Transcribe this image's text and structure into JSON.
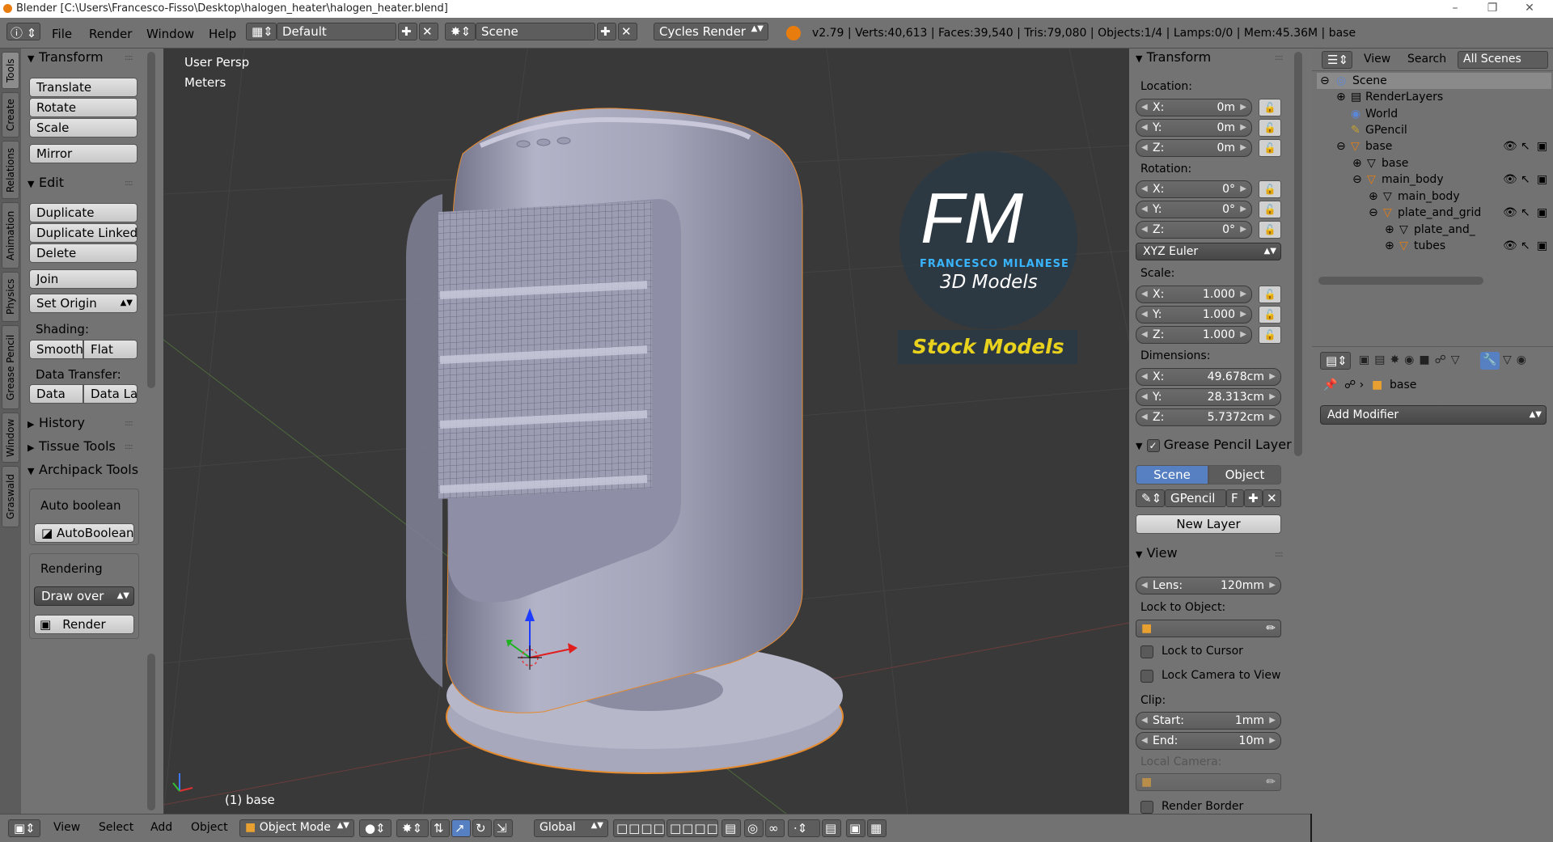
{
  "window": {
    "title": "Blender [C:\\Users\\Francesco-Fisso\\Desktop\\halogen_heater\\halogen_heater.blend]"
  },
  "info": {
    "menus": [
      "File",
      "Render",
      "Window",
      "Help"
    ],
    "layout": "Default",
    "scene": "Scene",
    "engine": "Cycles Render",
    "stats": "v2.79 | Verts:40,613 | Faces:39,540 | Tris:79,080 | Objects:1/4 | Lamps:0/0 | Mem:45.36M | base"
  },
  "tooltabs": [
    "Tools",
    "Create",
    "Relations",
    "Animation",
    "Physics",
    "Grease Pencil",
    "Window",
    "Graswald"
  ],
  "toolshelf": {
    "transform_title": "Transform",
    "translate": "Translate",
    "rotate": "Rotate",
    "scale": "Scale",
    "mirror": "Mirror",
    "edit_title": "Edit",
    "duplicate": "Duplicate",
    "duplicate_linked": "Duplicate Linked",
    "delete": "Delete",
    "join": "Join",
    "set_origin": "Set Origin",
    "shading_label": "Shading:",
    "smooth": "Smooth",
    "flat": "Flat",
    "data_transfer_label": "Data Transfer:",
    "data": "Data",
    "data_la": "Data La",
    "history": "History",
    "tissue": "Tissue Tools",
    "archipack": "Archipack Tools",
    "auto_boolean_label": "Auto boolean",
    "autoboolean": "AutoBoolean",
    "rendering_label": "Rendering",
    "draw_over": "Draw over",
    "render": "Render"
  },
  "viewport": {
    "view_name": "User Persp",
    "units": "Meters",
    "object_label": "(1) base",
    "logo_letters": "FM",
    "logo_name": "FRANCESCO MILANESE",
    "logo_sub": "3D Models",
    "logo_stock": "Stock Models"
  },
  "npanel": {
    "transform_title": "Transform",
    "location_label": "Location:",
    "loc": [
      {
        "axis": "X:",
        "value": "0m"
      },
      {
        "axis": "Y:",
        "value": "0m"
      },
      {
        "axis": "Z:",
        "value": "0m"
      }
    ],
    "rotation_label": "Rotation:",
    "rot": [
      {
        "axis": "X:",
        "value": "0°"
      },
      {
        "axis": "Y:",
        "value": "0°"
      },
      {
        "axis": "Z:",
        "value": "0°"
      }
    ],
    "rotation_mode": "XYZ Euler",
    "scale_label": "Scale:",
    "scl": [
      {
        "axis": "X:",
        "value": "1.000"
      },
      {
        "axis": "Y:",
        "value": "1.000"
      },
      {
        "axis": "Z:",
        "value": "1.000"
      }
    ],
    "dimensions_label": "Dimensions:",
    "dim": [
      {
        "axis": "X:",
        "value": "49.678cm"
      },
      {
        "axis": "Y:",
        "value": "28.313cm"
      },
      {
        "axis": "Z:",
        "value": "5.7372cm"
      }
    ],
    "gp_title": "Grease Pencil Layer",
    "gp_scene": "Scene",
    "gp_object": "Object",
    "gp_name": "GPencil",
    "gp_f": "F",
    "new_layer": "New Layer",
    "view_title": "View",
    "lens_label": "Lens:",
    "lens_value": "120mm",
    "lock_object_label": "Lock to Object:",
    "lock_cursor": "Lock to Cursor",
    "lock_camera": "Lock Camera to View",
    "clip_label": "Clip:",
    "clip_start_label": "Start:",
    "clip_start": "1mm",
    "clip_end_label": "End:",
    "clip_end": "10m",
    "local_camera_label": "Local Camera:",
    "render_border": "Render Border"
  },
  "outliner": {
    "view": "View",
    "search": "Search",
    "scope": "All Scenes",
    "items": [
      "Scene",
      "RenderLayers",
      "World",
      "GPencil",
      "base",
      "base",
      "main_body",
      "main_body",
      "plate_and_grid",
      "plate_and_",
      "tubes"
    ]
  },
  "properties": {
    "object": "base",
    "add_modifier": "Add Modifier"
  },
  "bottombar": {
    "menus": [
      "View",
      "Select",
      "Add",
      "Object"
    ],
    "mode": "Object Mode",
    "orientation": "Global"
  },
  "colors": {
    "accent": "#5680c2",
    "orange": "#e87d0d",
    "viewport": "#393939",
    "panel": "#737373"
  }
}
